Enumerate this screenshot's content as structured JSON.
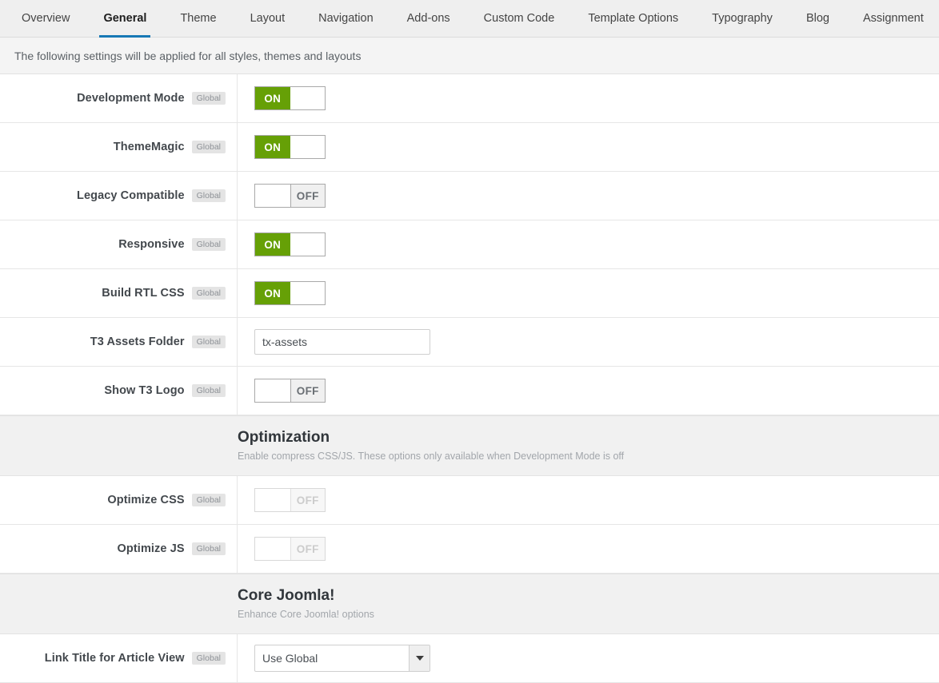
{
  "tabs": [
    {
      "label": "Overview",
      "active": false
    },
    {
      "label": "General",
      "active": true
    },
    {
      "label": "Theme",
      "active": false
    },
    {
      "label": "Layout",
      "active": false
    },
    {
      "label": "Navigation",
      "active": false
    },
    {
      "label": "Add-ons",
      "active": false
    },
    {
      "label": "Custom Code",
      "active": false
    },
    {
      "label": "Template Options",
      "active": false
    },
    {
      "label": "Typography",
      "active": false
    },
    {
      "label": "Blog",
      "active": false
    },
    {
      "label": "Assignment",
      "active": false
    }
  ],
  "info_bar": {
    "text": "The following settings will be applied for all styles, themes and layouts"
  },
  "badge_label": "Global",
  "toggle_labels": {
    "on": "ON",
    "off": "OFF"
  },
  "colors": {
    "toggle_on_green": "#66a006",
    "active_tab_underline": "#1678b5",
    "section_background": "#f1f1f1",
    "badge_background": "#e4e4e4"
  },
  "rows": [
    {
      "label": "Development Mode",
      "badge": "Global",
      "control": "toggle",
      "state": "on",
      "value": "ON",
      "disabled": false
    },
    {
      "label": "ThemeMagic",
      "badge": "Global",
      "control": "toggle",
      "state": "on",
      "value": "ON",
      "disabled": false
    },
    {
      "label": "Legacy Compatible",
      "badge": "Global",
      "control": "toggle",
      "state": "off",
      "value": "OFF",
      "disabled": false
    },
    {
      "label": "Responsive",
      "badge": "Global",
      "control": "toggle",
      "state": "on",
      "value": "ON",
      "disabled": false
    },
    {
      "label": "Build RTL CSS",
      "badge": "Global",
      "control": "toggle",
      "state": "on",
      "value": "ON",
      "disabled": false
    },
    {
      "label": "T3 Assets Folder",
      "badge": "Global",
      "control": "text",
      "value": "tx-assets",
      "placeholder": ""
    },
    {
      "label": "Show T3 Logo",
      "badge": "Global",
      "control": "toggle",
      "state": "off",
      "value": "OFF",
      "disabled": false
    }
  ],
  "optimization_section": {
    "title": "Optimization",
    "description": "Enable compress CSS/JS. These options only available when Development Mode is off",
    "rows": [
      {
        "label": "Optimize CSS",
        "badge": "Global",
        "control": "toggle",
        "state": "off",
        "value": "OFF",
        "disabled": true
      },
      {
        "label": "Optimize JS",
        "badge": "Global",
        "control": "toggle",
        "state": "off",
        "value": "OFF",
        "disabled": true
      }
    ]
  },
  "core_joomla_section": {
    "title": "Core Joomla!",
    "description": "Enhance Core Joomla! options",
    "rows": [
      {
        "label": "Link Title for Article View",
        "badge": "Global",
        "control": "select",
        "value": "Use Global"
      }
    ]
  }
}
